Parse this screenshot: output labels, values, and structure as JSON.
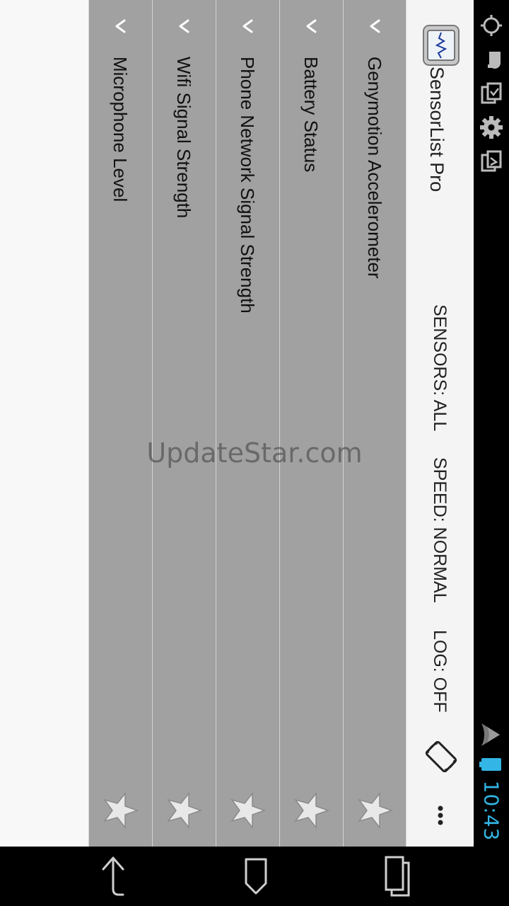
{
  "app": {
    "title": "SensorList Pro",
    "sensors_filter": "SENSORS: ALL",
    "speed": "SPEED: NORMAL",
    "log": "LOG: OFF"
  },
  "status_bar": {
    "time": "10:43",
    "icons": [
      "gps-icon",
      "notification-icon",
      "copy-icon",
      "settings-icon",
      "clipboard-icon",
      "wifi-icon",
      "battery-icon"
    ]
  },
  "sensors": [
    {
      "label": "Genymotion Accelerometer",
      "favorite": false
    },
    {
      "label": "Battery Status",
      "favorite": false
    },
    {
      "label": "Phone Network Signal Strength",
      "favorite": false
    },
    {
      "label": "Wifi Signal Strength",
      "favorite": false
    },
    {
      "label": "Microphone Level",
      "favorite": false
    }
  ],
  "watermark": "UpdateStar.com",
  "colors": {
    "accent": "#33b5e5",
    "list_bg": "#a1a1a1",
    "actionbar_bg": "#f4f4f4"
  },
  "nav": {
    "buttons": [
      "back-icon",
      "home-icon",
      "recents-icon"
    ]
  }
}
